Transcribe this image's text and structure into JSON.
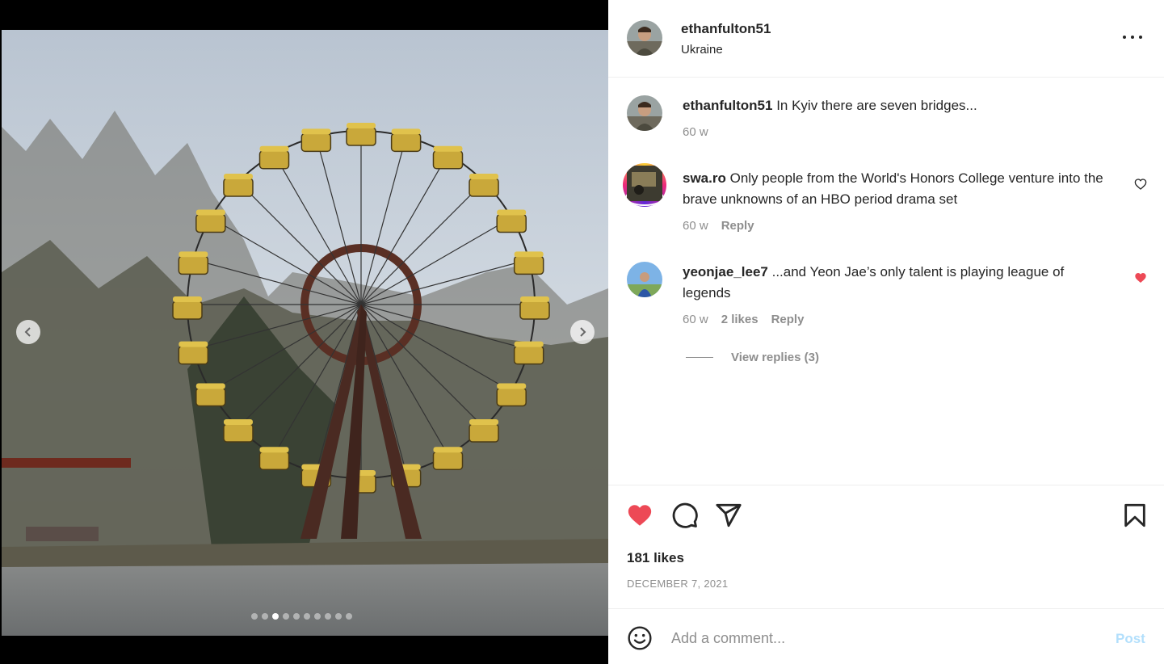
{
  "post": {
    "author": "ethanfulton51",
    "location": "Ukraine",
    "carousel": {
      "total_slides": 10,
      "active_slide": 3
    },
    "likes_text": "181 likes",
    "date_text": "DECEMBER 7, 2021"
  },
  "comments": [
    {
      "username": "ethanfulton51",
      "text": "In Kyiv there are seven bridges...",
      "age": "60 w",
      "likes": "",
      "reply": "",
      "liked": false
    },
    {
      "username": "swa.ro",
      "text": "Only people from the World's Honors College venture into the brave unknowns of an HBO period drama set",
      "age": "60 w",
      "likes": "",
      "reply": "Reply",
      "liked": false
    },
    {
      "username": "yeonjae_lee7",
      "text": "...and Yeon Jae’s only talent is playing league of legends",
      "age": "60 w",
      "likes": "2 likes",
      "reply": "Reply",
      "liked": true
    }
  ],
  "view_replies": "View replies (3)",
  "composer": {
    "placeholder": "Add a comment...",
    "post_label": "Post"
  },
  "icons": {
    "like": "heart-filled-icon",
    "comment": "comment-bubble-icon",
    "share": "paper-plane-icon",
    "save": "bookmark-icon",
    "more": "more-horizontal-icon",
    "emoji": "emoji-icon",
    "prev": "chevron-left-icon",
    "next": "chevron-right-icon"
  },
  "colors": {
    "like_red": "#ed4956",
    "post_blue_disabled": "#b2dffc",
    "muted_gray": "#8e8e8e"
  }
}
